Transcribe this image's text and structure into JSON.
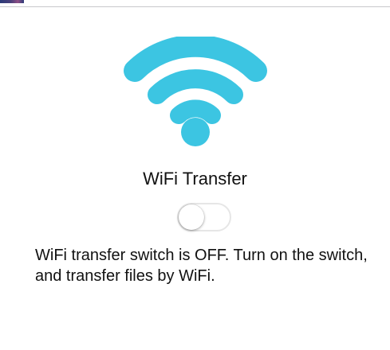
{
  "app": {
    "accent_color": "#3cc5e2",
    "icon": "wifi-icon"
  },
  "screen": {
    "title": "WiFi Transfer",
    "description": "WiFi transfer switch is OFF. Turn on the switch, and transfer files by WiFi."
  },
  "toggle": {
    "state": "off"
  }
}
